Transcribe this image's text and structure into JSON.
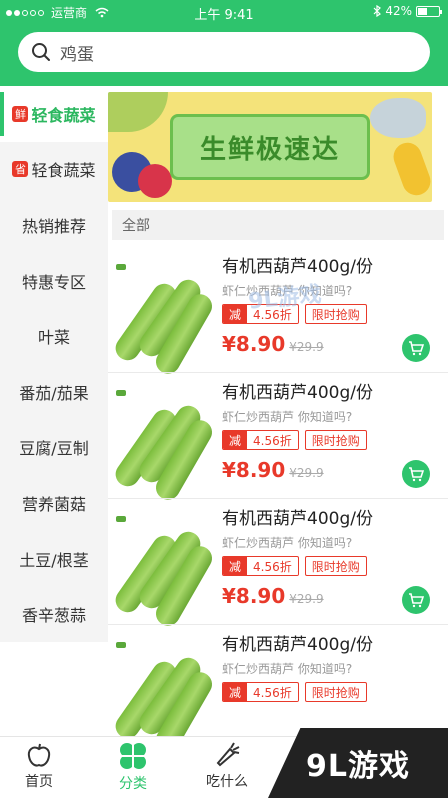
{
  "status_bar": {
    "carrier": "运营商",
    "time": "上午 9:41",
    "battery": "42%",
    "signal_dots": 5,
    "signal_filled": 2
  },
  "search": {
    "placeholder": "鸡蛋"
  },
  "banner": {
    "title": "生鲜极速达"
  },
  "sidebar": {
    "items": [
      {
        "label": "轻食蔬菜",
        "tag": "鲜",
        "active": true
      },
      {
        "label": "轻食蔬菜",
        "tag": "省",
        "active": false
      },
      {
        "label": "热销推荐",
        "tag": "",
        "active": false
      },
      {
        "label": "特惠专区",
        "tag": "",
        "active": false
      },
      {
        "label": "叶菜",
        "tag": "",
        "active": false
      },
      {
        "label": "番茄/茄果",
        "tag": "",
        "active": false
      },
      {
        "label": "豆腐/豆制",
        "tag": "",
        "active": false
      },
      {
        "label": "营养菌菇",
        "tag": "",
        "active": false
      },
      {
        "label": "土豆/根茎",
        "tag": "",
        "active": false
      },
      {
        "label": "香辛葱蒜",
        "tag": "",
        "active": false
      }
    ]
  },
  "list": {
    "header": "全部",
    "products": [
      {
        "title": "有机西葫芦400g/份",
        "subtitle": "虾仁炒西葫芦 你知道吗?",
        "discount_tag": "减",
        "discount": "4.56折",
        "flash": "限时抢购",
        "price": "¥8.90",
        "old_price": "¥29.9"
      },
      {
        "title": "有机西葫芦400g/份",
        "subtitle": "虾仁炒西葫芦 你知道吗?",
        "discount_tag": "减",
        "discount": "4.56折",
        "flash": "限时抢购",
        "price": "¥8.90",
        "old_price": "¥29.9"
      },
      {
        "title": "有机西葫芦400g/份",
        "subtitle": "虾仁炒西葫芦 你知道吗?",
        "discount_tag": "减",
        "discount": "4.56折",
        "flash": "限时抢购",
        "price": "¥8.90",
        "old_price": "¥29.9"
      },
      {
        "title": "有机西葫芦400g/份",
        "subtitle": "虾仁炒西葫芦 你知道吗?",
        "discount_tag": "减",
        "discount": "4.56折",
        "flash": "限时抢购",
        "price": "",
        "old_price": ""
      }
    ]
  },
  "bottom_nav": {
    "items": [
      {
        "label": "首页",
        "icon": "apple-icon",
        "active": false
      },
      {
        "label": "分类",
        "icon": "clover-icon",
        "active": true
      },
      {
        "label": "吃什么",
        "icon": "carrot-icon",
        "active": false
      }
    ]
  },
  "watermark": {
    "text": "9L游戏",
    "center_text": "9L游戏"
  },
  "colors": {
    "brand_green": "#2ec46d",
    "price_red": "#e8392a",
    "sidebar_bg": "#f4f4f4"
  }
}
